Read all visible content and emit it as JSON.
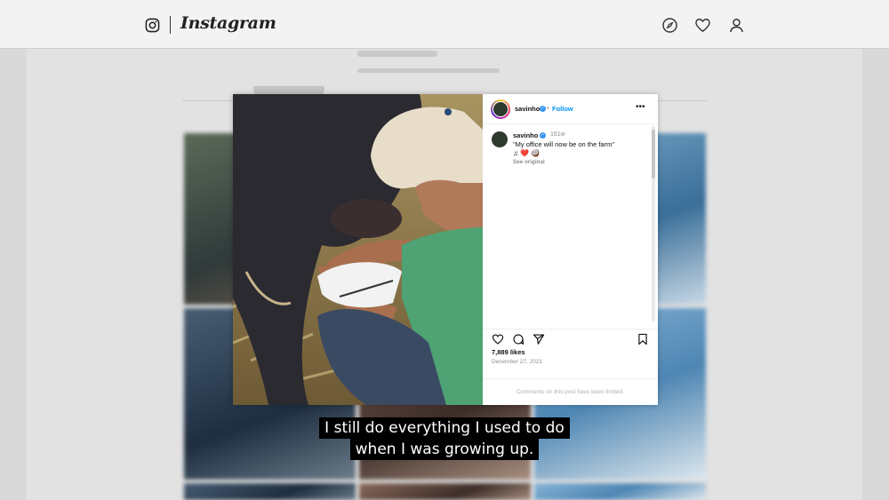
{
  "app": {
    "name": "Instagram"
  },
  "nav": {
    "icons": [
      "explore-icon",
      "heart-icon",
      "profile-icon"
    ]
  },
  "post": {
    "username": "savinho",
    "follow_label": "Follow",
    "separator": "•",
    "more_label": "•••",
    "caption": {
      "username": "savinho",
      "time_ago": "161w",
      "text": "\"My office will now be on the farm\"",
      "emojis": "♫ ❤️ 🥥",
      "see_original": "See original"
    },
    "likes": "7,889 likes",
    "date": "December 27, 2021",
    "comments_notice": "Comments on this post have been limited."
  },
  "subtitle": {
    "line1": "I still do everything I used to do",
    "line2": "when I was growing up."
  },
  "colors": {
    "link_blue": "#0095f6",
    "verified_blue": "#3897f0",
    "muted_text": "#8e8e8e"
  }
}
